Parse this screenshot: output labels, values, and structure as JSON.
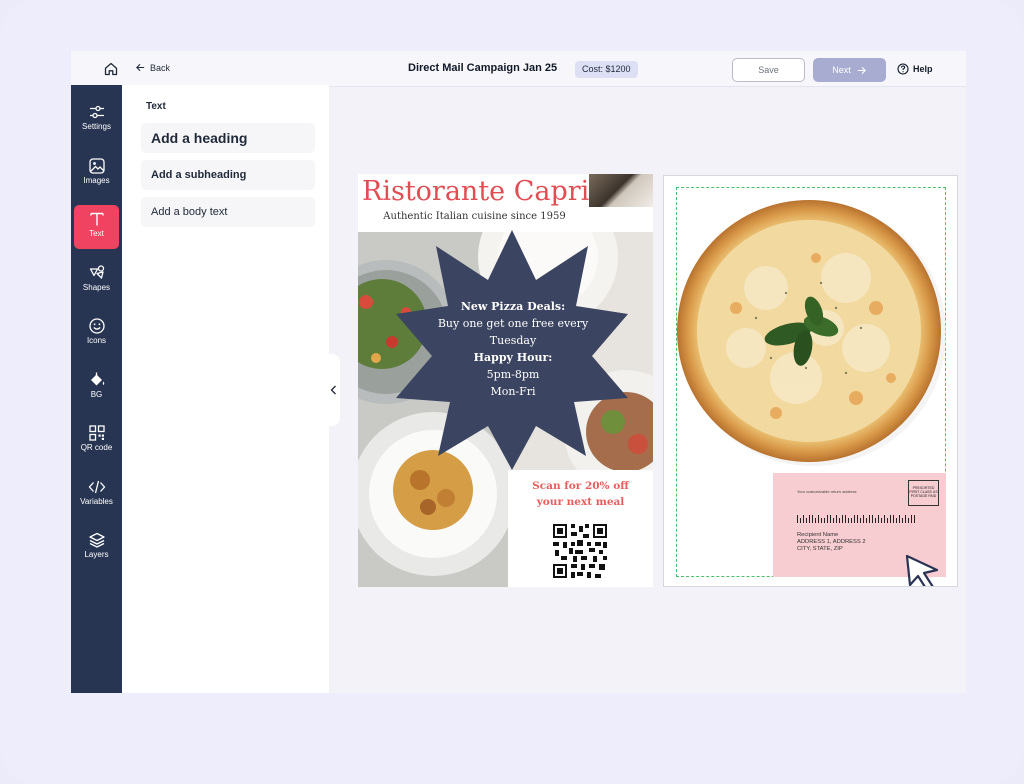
{
  "header": {
    "back_label": "Back",
    "title": "Direct Mail Campaign Jan 25",
    "cost": "Cost: $1200",
    "save_label": "Save",
    "next_label": "Next",
    "help_label": "Help"
  },
  "toolbar": {
    "items": [
      {
        "label": "Settings",
        "icon": "settings-icon"
      },
      {
        "label": "Images",
        "icon": "image-icon"
      },
      {
        "label": "Text",
        "icon": "text-icon"
      },
      {
        "label": "Shapes",
        "icon": "shapes-icon"
      },
      {
        "label": "Icons",
        "icon": "smiley-icon"
      },
      {
        "label": "BG",
        "icon": "paint-bucket-icon"
      },
      {
        "label": "QR code",
        "icon": "qr-code-icon"
      },
      {
        "label": "Variables",
        "icon": "code-icon"
      },
      {
        "label": "Layers",
        "icon": "layers-icon"
      }
    ],
    "active": "Text"
  },
  "panel": {
    "title": "Text",
    "heading": "Add a heading",
    "subheading": "Add a subheading",
    "body": "Add a body text"
  },
  "postcard_front": {
    "brand": "Ristorante Capri",
    "tagline": "Authentic Italian cuisine since 1959",
    "deal_title": "New Pizza Deals:",
    "deal_line": "Buy one get one free every Tuesday",
    "happy_hour": "Happy Hour:",
    "hours": "5pm-8pm",
    "days": "Mon-Fri",
    "promo_line1": "Scan for 20% off",
    "promo_line2": "your next meal"
  },
  "postcard_back": {
    "return_address": "Your customizable return address",
    "stamp_text": "PRESORTED FIRST CLASS US POSTAGE PAID",
    "recipient_name": "Recipient Name",
    "address_line": "ADDRESS 1, ADDRESS 2",
    "city_line": "CITY, STATE, ZIP"
  },
  "colors": {
    "toolbar_bg": "#283552",
    "active_tool": "#ef4361",
    "brand_red": "#e14d53",
    "starburst": "#3b4460",
    "address_block": "#f7cdd1"
  }
}
